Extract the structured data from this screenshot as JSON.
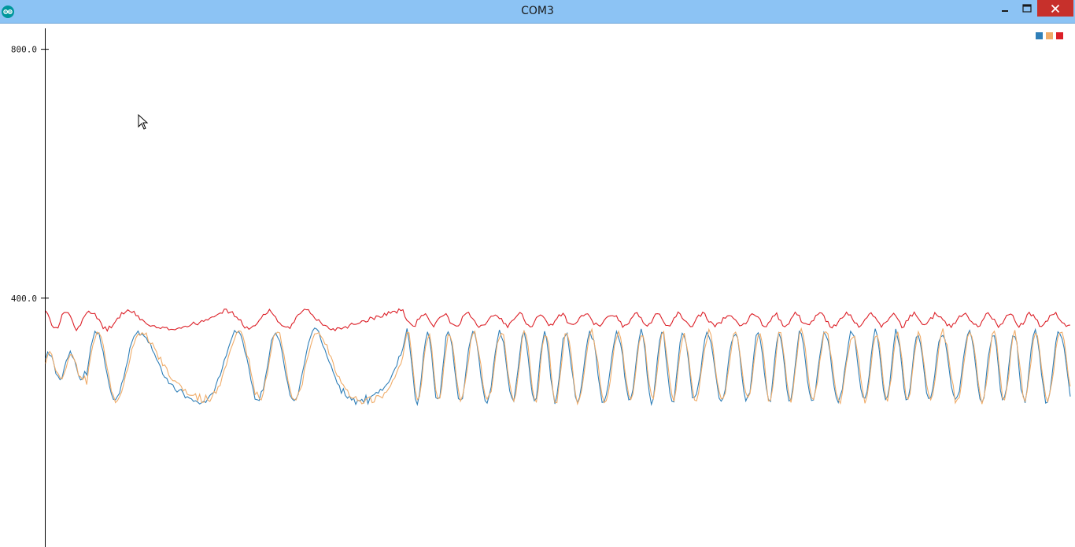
{
  "window": {
    "title": "COM3",
    "app_icon": "arduino-logo-icon",
    "controls": [
      "minimize-icon",
      "maximize-icon",
      "close-icon"
    ],
    "titlebar_color": "#8cc3f4",
    "close_color": "#c7302b"
  },
  "chart_data": {
    "type": "line",
    "title": "",
    "xlabel": "",
    "ylabel": "",
    "ylim": [
      0,
      840
    ],
    "yticks": [
      {
        "value": 800,
        "label": "800.0"
      },
      {
        "value": 400,
        "label": "400.0"
      }
    ],
    "x": {
      "count": 500
    },
    "legend": {
      "placement": "top-right"
    },
    "grid": false,
    "series": [
      {
        "color": "#2f7fb8",
        "baseline": 290,
        "amplitude": 60,
        "style": "signal"
      },
      {
        "color": "#f0ac69",
        "baseline": 290,
        "amplitude": 58,
        "style": "signal-lag"
      },
      {
        "color": "#dc1f27",
        "baseline": 365,
        "amplitude": 12,
        "style": "envelope"
      }
    ]
  }
}
